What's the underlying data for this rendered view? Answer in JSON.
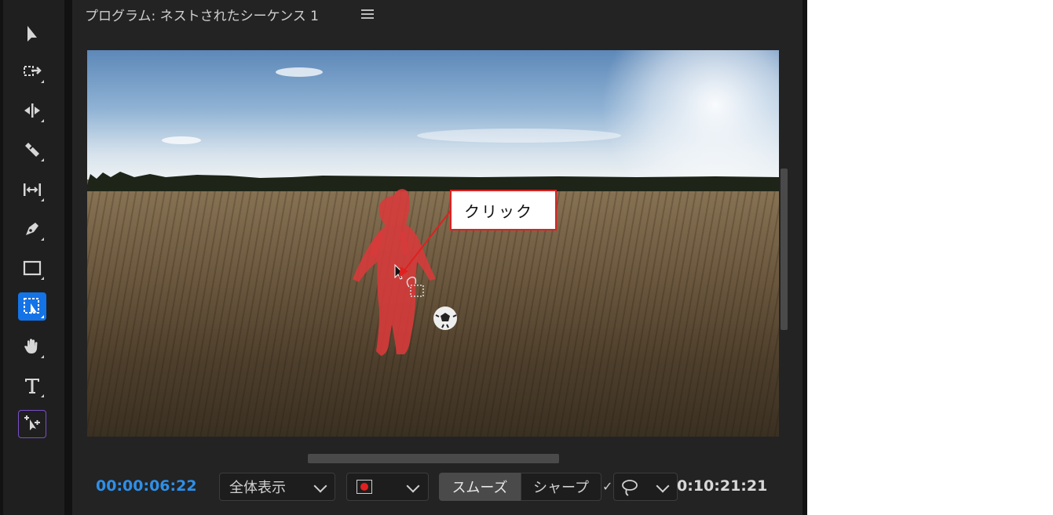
{
  "panel": {
    "title": "プログラム: ネストされたシーケンス 1"
  },
  "tools": [
    {
      "name": "selection-tool",
      "icon": "arrow-pointer-icon"
    },
    {
      "name": "track-select-tool",
      "icon": "track-select-icon"
    },
    {
      "name": "ripple-edit-tool",
      "icon": "ripple-edit-icon"
    },
    {
      "name": "razor-tool",
      "icon": "razor-icon"
    },
    {
      "name": "slip-tool",
      "icon": "slip-icon"
    },
    {
      "name": "pen-tool",
      "icon": "pen-icon"
    },
    {
      "name": "rectangle-tool",
      "icon": "rectangle-icon"
    },
    {
      "name": "object-selection-tool",
      "icon": "object-select-icon",
      "active": true
    },
    {
      "name": "hand-tool",
      "icon": "hand-icon"
    },
    {
      "name": "type-tool",
      "icon": "type-icon"
    },
    {
      "name": "auto-reframe-tool",
      "icon": "reframe-icon"
    }
  ],
  "annotation": {
    "callout": "クリック",
    "color": "#e02020"
  },
  "footer": {
    "current_timecode": "00:00:06:22",
    "fit_label": "全体表示",
    "mode_smooth": "スムーズ",
    "mode_sharp": "シャープ",
    "duration_timecode": "0:10:21:21"
  },
  "colors": {
    "accent": "#2e8fe8",
    "active_tool": "#1473e6",
    "mask": "#e02020"
  }
}
